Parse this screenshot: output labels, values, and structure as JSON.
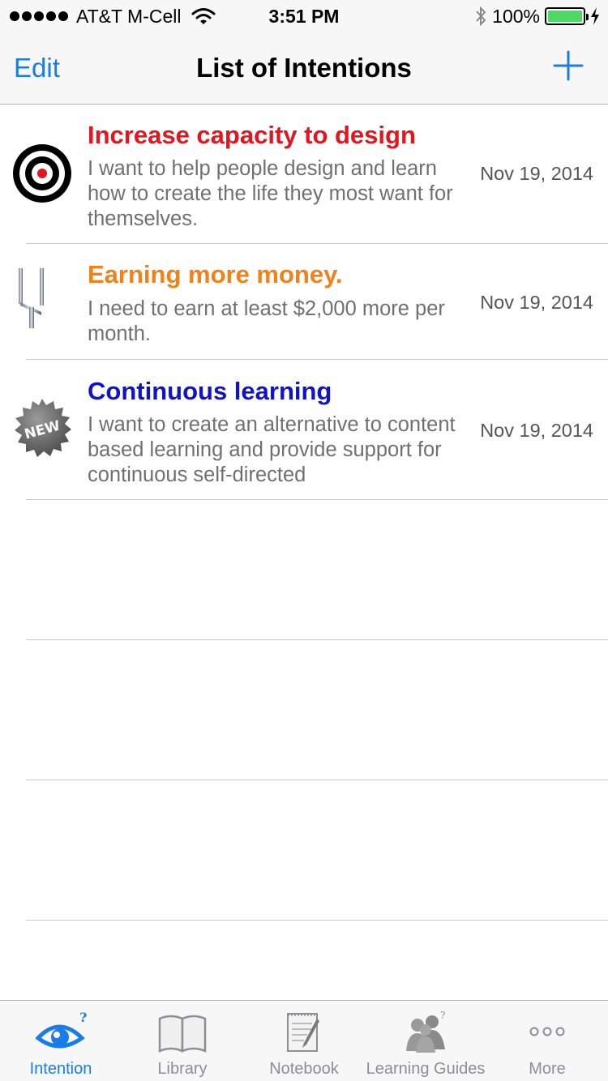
{
  "status_bar": {
    "carrier": "AT&T M-Cell",
    "time": "3:51 PM",
    "battery": "100%"
  },
  "nav": {
    "edit_label": "Edit",
    "title": "List of Intentions",
    "add_icon": "plus-icon"
  },
  "intentions": [
    {
      "icon": "target-icon",
      "title": "Increase capacity to design",
      "title_color": "#e3161f",
      "description": "I want to help people design and learn how to create the life they most want for themselves.",
      "date": "Nov 19, 2014"
    },
    {
      "icon": "goalpost-icon",
      "title": "Earning more money.",
      "title_color": "#f08218",
      "description": "I need to earn at least $2,000 more per month.",
      "date": "Nov 19, 2014"
    },
    {
      "icon": "new-badge-icon",
      "badge_text": "NEW",
      "title": "Continuous learning",
      "title_color": "#0f13c9",
      "description": "I want to create an alternative to content based learning and provide support for continuous self-directed",
      "date": "Nov 19, 2014"
    }
  ],
  "tabs": [
    {
      "label": "Intention",
      "icon": "eye-icon",
      "active": true
    },
    {
      "label": "Library",
      "icon": "book-icon",
      "active": false
    },
    {
      "label": "Notebook",
      "icon": "notebook-icon",
      "active": false
    },
    {
      "label": "Learning Guides",
      "icon": "people-icon",
      "active": false
    },
    {
      "label": "More",
      "icon": "more-icon",
      "active": false
    }
  ],
  "colors": {
    "accent": "#1a7ce6",
    "inactive": "#8e8e93"
  }
}
